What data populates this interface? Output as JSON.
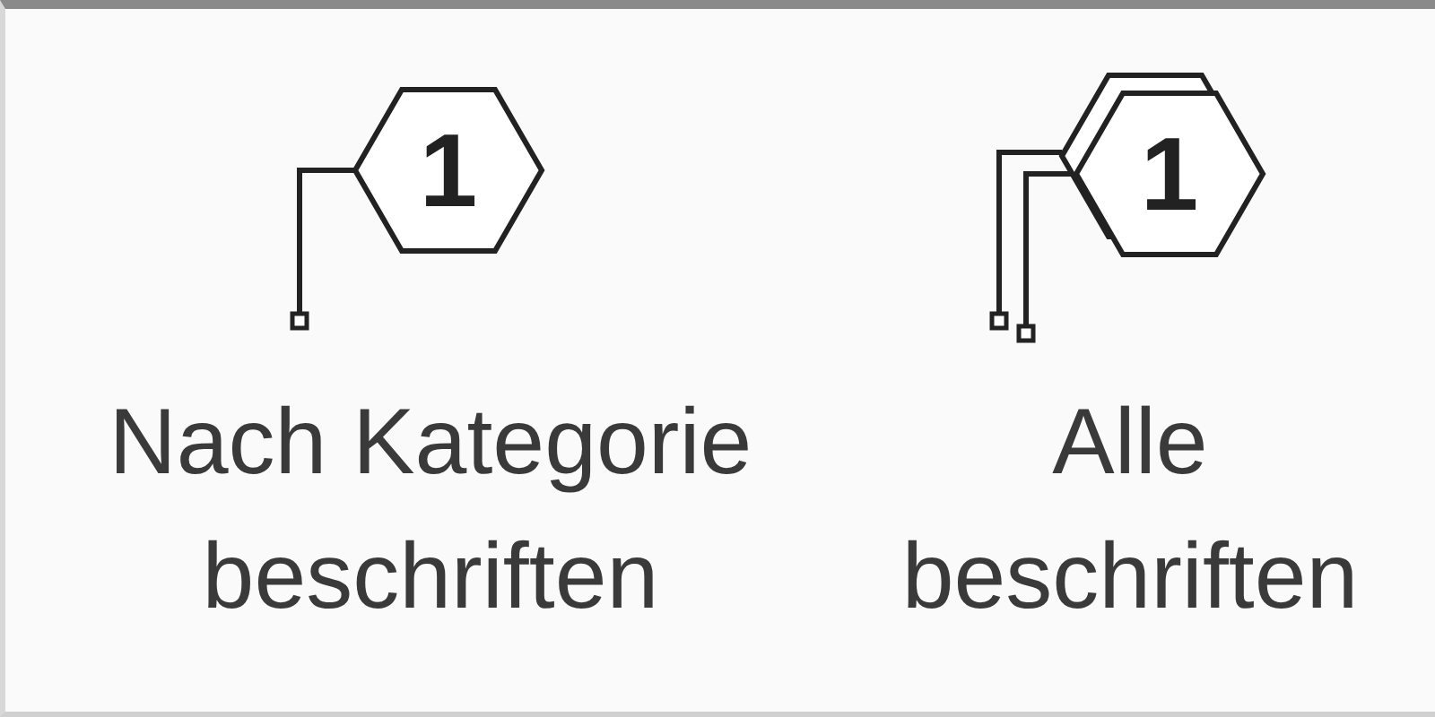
{
  "ribbon": {
    "buttons": [
      {
        "kind": "single",
        "tag": "1",
        "label": "Nach Kategorie\nbeschriften"
      },
      {
        "kind": "multiple",
        "tag": "1",
        "label": "Alle\nbeschriften"
      }
    ]
  }
}
